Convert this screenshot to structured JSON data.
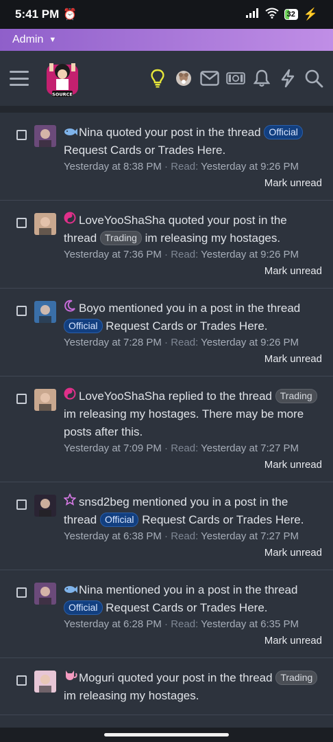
{
  "status_bar": {
    "time": "5:41 PM",
    "battery": "32"
  },
  "admin_bar": {
    "label": "Admin"
  },
  "header": {
    "logo_text": "SOURCE",
    "icons": [
      "menu-icon",
      "lightbulb-icon",
      "guild-icon",
      "mail-icon",
      "money-icon",
      "bell-icon",
      "lightning-icon",
      "search-icon"
    ]
  },
  "alerts": [
    {
      "user": "Nina",
      "action": "quoted your post in the thread",
      "prefix": "Official",
      "prefix_type": "official",
      "thread": "Request Cards or Trades Here.",
      "suffix": "",
      "time": "Yesterday at 8:38 PM",
      "read_label": "Read:",
      "read_time": "Yesterday at 9:26 PM",
      "mark": "Mark unread",
      "user_icon": "fish-icon",
      "avatar_color": "#6b4a7a"
    },
    {
      "user": "LoveYooShaSha",
      "action": "quoted your post in the thread",
      "prefix": "Trading",
      "prefix_type": "trading",
      "thread": "im releasing my hostages.",
      "suffix": "",
      "time": "Yesterday at 7:36 PM",
      "read_label": "Read:",
      "read_time": "Yesterday at 9:26 PM",
      "mark": "Mark unread",
      "user_icon": "swirl-icon",
      "avatar_color": "#c9a88f"
    },
    {
      "user": "Boyo",
      "action": "mentioned you in a post in the thread",
      "prefix": "Official",
      "prefix_type": "official",
      "thread": "Request Cards or Trades Here.",
      "suffix": "",
      "time": "Yesterday at 7:28 PM",
      "read_label": "Read:",
      "read_time": "Yesterday at 9:26 PM",
      "mark": "Mark unread",
      "user_icon": "moon-icon",
      "avatar_color": "#3a6fa8"
    },
    {
      "user": "LoveYooShaSha",
      "action": "replied to the thread",
      "prefix": "Trading",
      "prefix_type": "trading",
      "thread": "im releasing my hostages.",
      "suffix": "There may be more posts after this.",
      "time": "Yesterday at 7:09 PM",
      "read_label": "Read:",
      "read_time": "Yesterday at 7:27 PM",
      "mark": "Mark unread",
      "user_icon": "swirl-icon",
      "avatar_color": "#c9a88f"
    },
    {
      "user": "snsd2beg",
      "action": "mentioned you in a post in the thread",
      "prefix": "Official",
      "prefix_type": "official",
      "thread": "Request Cards or Trades Here.",
      "suffix": "",
      "time": "Yesterday at 6:38 PM",
      "read_label": "Read:",
      "read_time": "Yesterday at 7:27 PM",
      "mark": "Mark unread",
      "user_icon": "star-icon",
      "avatar_color": "#2a2433"
    },
    {
      "user": "Nina",
      "action": "mentioned you in a post in the thread",
      "prefix": "Official",
      "prefix_type": "official",
      "thread": "Request Cards or Trades Here.",
      "suffix": "",
      "time": "Yesterday at 6:28 PM",
      "read_label": "Read:",
      "read_time": "Yesterday at 6:35 PM",
      "mark": "Mark unread",
      "user_icon": "fish-icon",
      "avatar_color": "#6b4a7a"
    },
    {
      "user": "Moguri",
      "action": "quoted your post in the thread",
      "prefix": "Trading",
      "prefix_type": "trading",
      "thread": "im releasing my hostages.",
      "suffix": "",
      "time": "",
      "read_label": "",
      "read_time": "",
      "mark": "",
      "user_icon": "cat-icon",
      "avatar_color": "#e7c6d6"
    }
  ]
}
